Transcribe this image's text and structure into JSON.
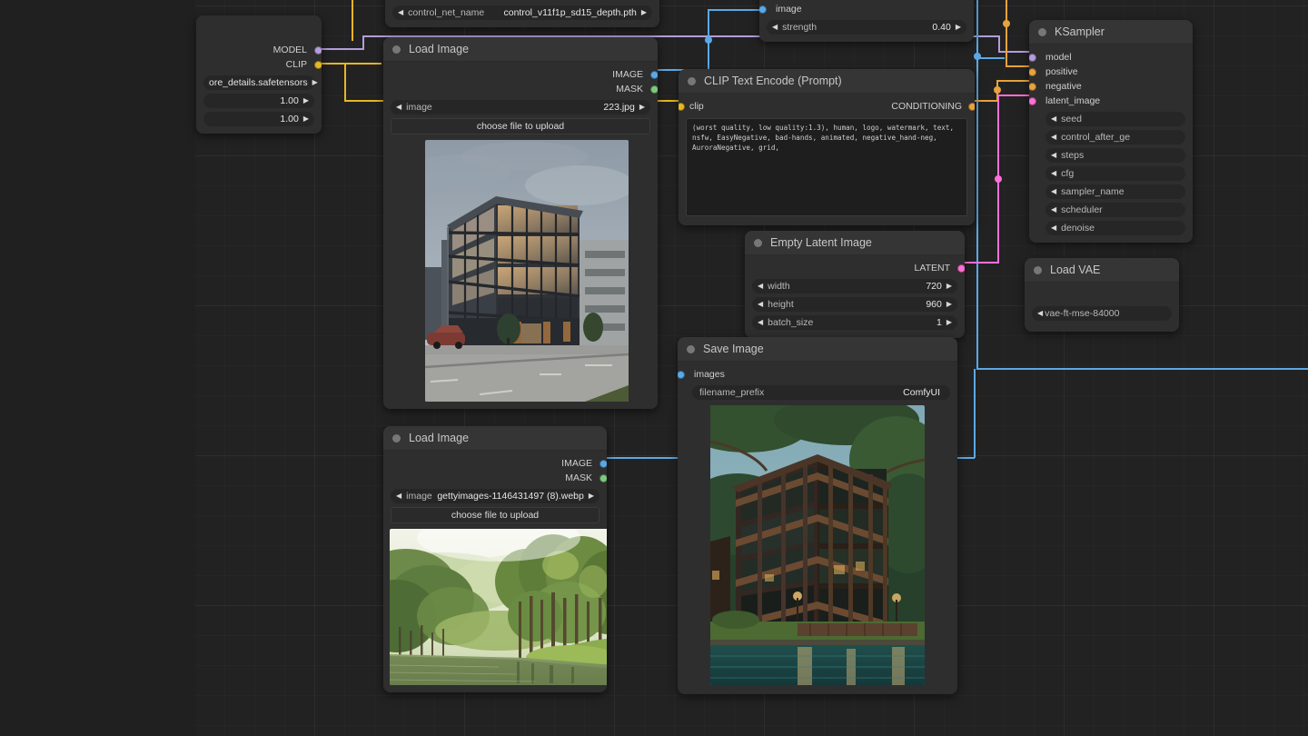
{
  "app": {
    "name": "ComfyUI",
    "canvas_bg": "#222222"
  },
  "colors": {
    "model": "#b39ddb",
    "clip": "#e5b723",
    "image": "#5aa9e6",
    "mask": "#7ec97e",
    "conditioning": "#e8a33d",
    "latent": "#ff6fd8",
    "vae": "#ff6e6e"
  },
  "nodes": {
    "lora_loader": {
      "title": "",
      "outputs": [
        {
          "label": "MODEL",
          "type": "model"
        },
        {
          "label": "CLIP",
          "type": "clip"
        }
      ],
      "widgets": [
        {
          "name": "",
          "value": "ore_details.safetensors"
        },
        {
          "name": "",
          "value": "1.00"
        },
        {
          "name": "",
          "value": "1.00"
        }
      ]
    },
    "controlnet_loader": {
      "widgets": [
        {
          "name": "control_net_name",
          "value": "control_v11f1p_sd15_depth.pth"
        }
      ]
    },
    "controlnet_apply": {
      "inputs": [
        {
          "label": "image",
          "type": "image"
        }
      ],
      "widgets": [
        {
          "name": "strength",
          "value": "0.40"
        }
      ]
    },
    "load_image_1": {
      "title": "Load Image",
      "outputs": [
        {
          "label": "IMAGE",
          "type": "image"
        },
        {
          "label": "MASK",
          "type": "mask"
        }
      ],
      "widgets": [
        {
          "name": "image",
          "value": "223.jpg"
        }
      ],
      "upload_button": "choose file to upload",
      "preview_alt": "modern glass office building at dusk"
    },
    "clip_text_encode": {
      "title": "CLIP Text Encode (Prompt)",
      "inputs": [
        {
          "label": "clip",
          "type": "clip"
        }
      ],
      "outputs": [
        {
          "label": "CONDITIONING",
          "type": "conditioning"
        }
      ],
      "prompt": "(worst quality, low quality:1.3), human, logo, watermark, text, nsfw, EasyNegative, bad-hands, animated, negative_hand-neg, AuroraNegative, grid,"
    },
    "ksampler": {
      "title": "KSampler",
      "inputs": [
        {
          "label": "model",
          "type": "model"
        },
        {
          "label": "positive",
          "type": "conditioning"
        },
        {
          "label": "negative",
          "type": "conditioning"
        },
        {
          "label": "latent_image",
          "type": "latent"
        }
      ],
      "widgets": [
        {
          "name": "seed",
          "value": ""
        },
        {
          "name": "control_after_ge",
          "value": ""
        },
        {
          "name": "steps",
          "value": ""
        },
        {
          "name": "cfg",
          "value": ""
        },
        {
          "name": "sampler_name",
          "value": ""
        },
        {
          "name": "scheduler",
          "value": ""
        },
        {
          "name": "denoise",
          "value": ""
        }
      ]
    },
    "empty_latent": {
      "title": "Empty Latent Image",
      "outputs": [
        {
          "label": "LATENT",
          "type": "latent"
        }
      ],
      "widgets": [
        {
          "name": "width",
          "value": "720"
        },
        {
          "name": "height",
          "value": "960"
        },
        {
          "name": "batch_size",
          "value": "1"
        }
      ]
    },
    "load_vae": {
      "title": "Load VAE",
      "widgets": [
        {
          "name": "",
          "value": "vae-ft-mse-84000"
        }
      ]
    },
    "save_image": {
      "title": "Save Image",
      "inputs": [
        {
          "label": "images",
          "type": "image"
        }
      ],
      "widgets": [
        {
          "name": "filename_prefix",
          "value": "ComfyUI"
        }
      ],
      "preview_alt": "wooden lakeside multi-storey building"
    },
    "load_image_2": {
      "title": "Load Image",
      "outputs": [
        {
          "label": "IMAGE",
          "type": "image"
        },
        {
          "label": "MASK",
          "type": "mask"
        }
      ],
      "widgets": [
        {
          "name": "image",
          "value": "gettyimages-1146431497 (8).webp"
        }
      ],
      "upload_button": "choose file to upload",
      "preview_alt": "misty forest lake with pine trees"
    }
  }
}
